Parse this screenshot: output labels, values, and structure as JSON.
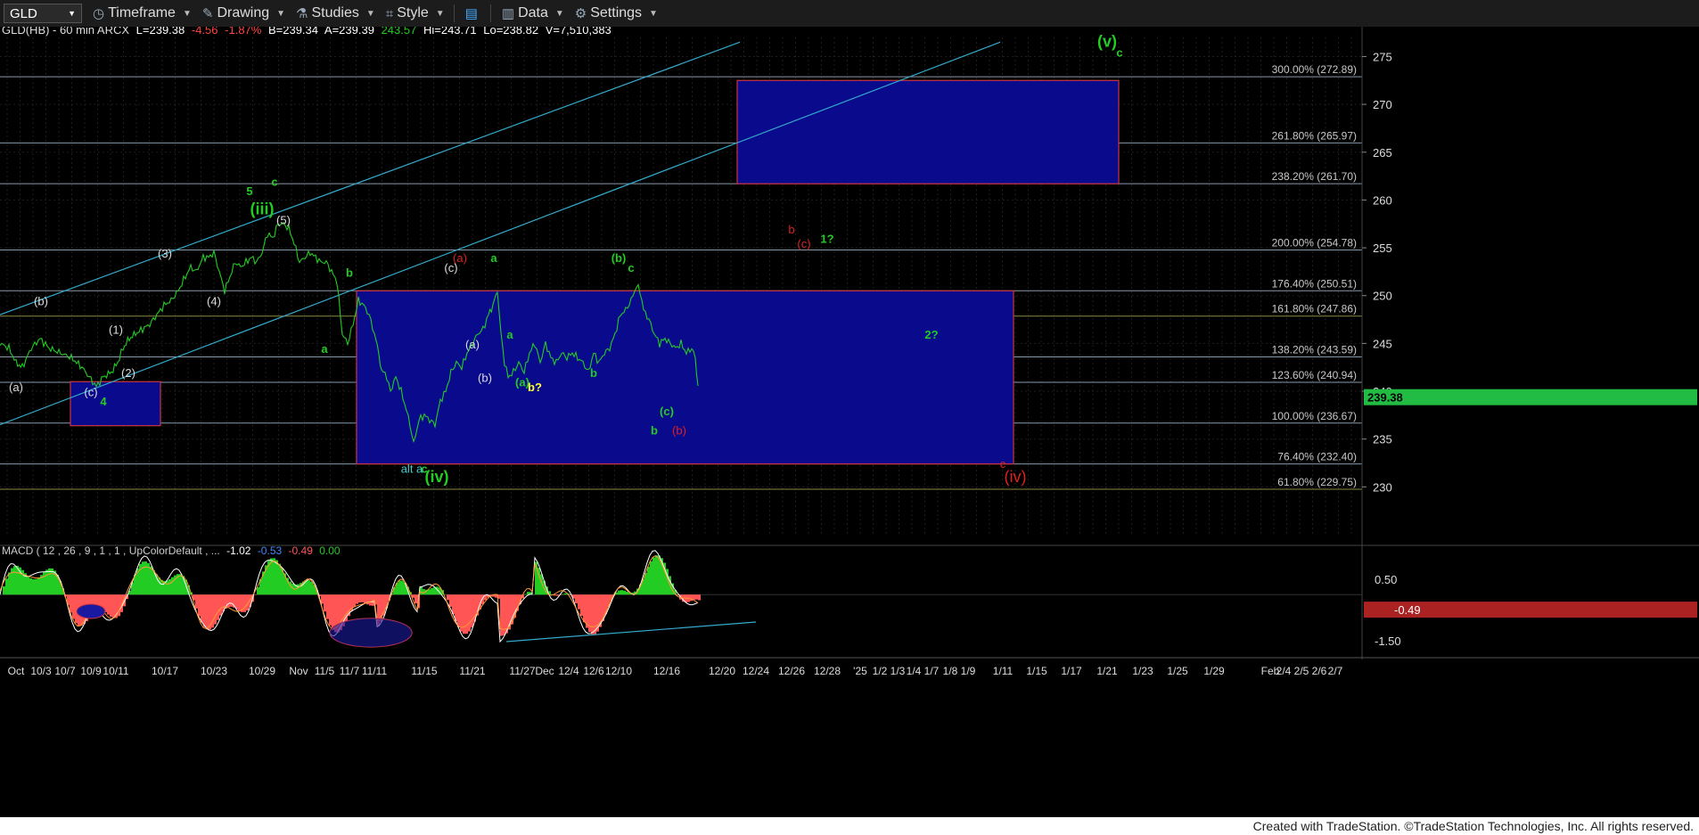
{
  "toolbar": {
    "symbol": "GLD",
    "timeframe_label": "Timeframe",
    "drawing_label": "Drawing",
    "studies_label": "Studies",
    "style_label": "Style",
    "data_label": "Data",
    "settings_label": "Settings",
    "icons": [
      "timeframe-icon",
      "drawing-icon",
      "studies-icon",
      "style-icon",
      "layout-icon",
      "data-icon",
      "settings-icon"
    ]
  },
  "header": {
    "line_prefix": "GLD(HB) - 60 min  ARCX",
    "last": "L=239.38",
    "change": "-4.56",
    "pct": "-1.87%",
    "bid": "B=239.34",
    "ask": "A=239.39",
    "open": "243.57",
    "hi": "Hi=243.71",
    "lo": "Lo=238.82",
    "vol": "V=7,510,383"
  },
  "colors": {
    "price_up": "#22cc22",
    "box_fill": "#0a0a8c",
    "box_border": "#cc3344",
    "fib_line": "#8899aa",
    "trend_line": "#33aacc",
    "green_label": "#22cc22",
    "red_label": "#dd2222",
    "white_label": "#dddddd",
    "yellow_label": "#ffff33",
    "last_price_bg": "#22bb44",
    "macd_neg": "#ff5555",
    "macd_pos": "#22cc22"
  },
  "chart_data": {
    "type": "line",
    "title": "GLD(HB) - 60 min",
    "xlabel": "",
    "ylabel": "",
    "ylim": [
      225,
      277
    ],
    "yticks": [
      230,
      235,
      240,
      245,
      250,
      255,
      260,
      265,
      270,
      275
    ],
    "xticks": [
      "Oct",
      "10/3",
      "10/7",
      "10/9",
      "10/11",
      "10/17",
      "10/23",
      "10/29",
      "Nov",
      "11/5",
      "11/7",
      "11/11",
      "11/15",
      "11/21",
      "11/27",
      "Dec",
      "12/4",
      "12/6",
      "12/10",
      "12/16",
      "12/20",
      "12/24",
      "12/26",
      "12/28",
      "'25",
      "1/2",
      "1/3",
      "1/4",
      "1/7",
      "1/8",
      "1/9",
      "1/11",
      "1/15",
      "1/17",
      "1/21",
      "1/23",
      "1/25",
      "1/29",
      "Feb",
      "2/4",
      "2/5",
      "2/6",
      "2/7"
    ],
    "last_price": "239.38",
    "price_path": [
      [
        0,
        245
      ],
      [
        10,
        244.5
      ],
      [
        18,
        243
      ],
      [
        25,
        242.5
      ],
      [
        35,
        244.5
      ],
      [
        45,
        245.5
      ],
      [
        55,
        244.5
      ],
      [
        68,
        244
      ],
      [
        80,
        243.5
      ],
      [
        92,
        242.5
      ],
      [
        100,
        241.5
      ],
      [
        108,
        240.5
      ],
      [
        116,
        241.5
      ],
      [
        125,
        242
      ],
      [
        132,
        243
      ],
      [
        138,
        244.5
      ],
      [
        145,
        245.5
      ],
      [
        152,
        246
      ],
      [
        160,
        246.5
      ],
      [
        168,
        247
      ],
      [
        176,
        248
      ],
      [
        184,
        249
      ],
      [
        192,
        249.5
      ],
      [
        200,
        250.5
      ],
      [
        208,
        252
      ],
      [
        214,
        253
      ],
      [
        220,
        252.5
      ],
      [
        228,
        254
      ],
      [
        234,
        254
      ],
      [
        240,
        254.5
      ],
      [
        246,
        252.5
      ],
      [
        252,
        250.5
      ],
      [
        258,
        252
      ],
      [
        264,
        253.5
      ],
      [
        270,
        253
      ],
      [
        276,
        253.5
      ],
      [
        282,
        254
      ],
      [
        288,
        253.5
      ],
      [
        294,
        254.5
      ],
      [
        300,
        256.5
      ],
      [
        306,
        256
      ],
      [
        312,
        257.5
      ],
      [
        318,
        257.5
      ],
      [
        324,
        257
      ],
      [
        330,
        255.5
      ],
      [
        336,
        253.5
      ],
      [
        342,
        254
      ],
      [
        348,
        254.5
      ],
      [
        354,
        254
      ],
      [
        360,
        253.5
      ],
      [
        366,
        253.5
      ],
      [
        372,
        252.5
      ],
      [
        378,
        251.5
      ],
      [
        384,
        246
      ],
      [
        390,
        245
      ],
      [
        396,
        247
      ],
      [
        402,
        249.5
      ],
      [
        408,
        249
      ],
      [
        414,
        248
      ],
      [
        420,
        246
      ],
      [
        425,
        244
      ],
      [
        428,
        242
      ],
      [
        432,
        242
      ],
      [
        438,
        240
      ],
      [
        444,
        241.5
      ],
      [
        450,
        240
      ],
      [
        456,
        238
      ],
      [
        460,
        236.5
      ],
      [
        464,
        234.5
      ],
      [
        470,
        237
      ],
      [
        476,
        237.5
      ],
      [
        482,
        237
      ],
      [
        488,
        236.5
      ],
      [
        494,
        239
      ],
      [
        500,
        240
      ],
      [
        506,
        242
      ],
      [
        512,
        243
      ],
      [
        518,
        242.5
      ],
      [
        524,
        244
      ],
      [
        530,
        245
      ],
      [
        536,
        246
      ],
      [
        542,
        246.5
      ],
      [
        548,
        248
      ],
      [
        553,
        249
      ],
      [
        558,
        250.5
      ],
      [
        562,
        246
      ],
      [
        566,
        243
      ],
      [
        570,
        241.5
      ],
      [
        576,
        242
      ],
      [
        582,
        243
      ],
      [
        588,
        242
      ],
      [
        594,
        244
      ],
      [
        600,
        245
      ],
      [
        606,
        243
      ],
      [
        612,
        245
      ],
      [
        618,
        243.5
      ],
      [
        624,
        243
      ],
      [
        630,
        244
      ],
      [
        636,
        243.5
      ],
      [
        642,
        244
      ],
      [
        648,
        243.5
      ],
      [
        654,
        243
      ],
      [
        660,
        242
      ],
      [
        666,
        244
      ],
      [
        672,
        243
      ],
      [
        678,
        244
      ],
      [
        684,
        244.5
      ],
      [
        690,
        246
      ],
      [
        696,
        248
      ],
      [
        702,
        248.5
      ],
      [
        708,
        249.5
      ],
      [
        714,
        251
      ],
      [
        718,
        250.5
      ],
      [
        722,
        248.5
      ],
      [
        728,
        247.5
      ],
      [
        734,
        246
      ],
      [
        740,
        245
      ],
      [
        746,
        245.5
      ],
      [
        752,
        245
      ],
      [
        758,
        244.5
      ],
      [
        764,
        245
      ],
      [
        770,
        244
      ],
      [
        776,
        244.5
      ],
      [
        780,
        243.5
      ],
      [
        783,
        240.5
      ],
      [
        785,
        239.38
      ]
    ],
    "fib_levels": [
      {
        "label": "300.00% (272.89)",
        "value": 272.89
      },
      {
        "label": "261.80% (265.97)",
        "value": 265.97
      },
      {
        "label": "238.20% (261.70)",
        "value": 261.7
      },
      {
        "label": "200.00% (254.78)",
        "value": 254.78
      },
      {
        "label": "176.40% (250.51)",
        "value": 250.51
      },
      {
        "label": "161.80% (247.86)",
        "value": 247.86
      },
      {
        "label": "138.20% (243.59)",
        "value": 243.59
      },
      {
        "label": "123.60% (240.94)",
        "value": 240.94
      },
      {
        "label": "100.00% (236.67)",
        "value": 236.67
      },
      {
        "label": "76.40% (232.40)",
        "value": 232.4
      },
      {
        "label": "61.80% (229.75)",
        "value": 229.75
      }
    ],
    "boxes": [
      {
        "name": "small-wave4-box",
        "y_top": 241.0,
        "y_bottom": 236.4,
        "x_range": [
          "10/7",
          "10/17"
        ]
      },
      {
        "name": "main-target-box",
        "y_top": 250.5,
        "y_bottom": 232.4,
        "x_range": [
          "11/7",
          "1/11"
        ]
      },
      {
        "name": "upper-target-box",
        "y_top": 272.5,
        "y_bottom": 261.7,
        "x_range": [
          "12/20",
          "1/23"
        ]
      }
    ],
    "wave_labels": [
      {
        "text": "(iii)",
        "color": "green",
        "price": 258.5,
        "pos": "10/29"
      },
      {
        "text": "c",
        "color": "green",
        "price": 261.5,
        "pos": "10/29"
      },
      {
        "text": "5",
        "color": "green",
        "price": 260.5,
        "pos": "10/29"
      },
      {
        "text": "(5)",
        "color": "white",
        "price": 257.5,
        "pos": "10/29"
      },
      {
        "text": "(3)",
        "color": "white",
        "price": 254,
        "pos": "10/17"
      },
      {
        "text": "(4)",
        "color": "white",
        "price": 249,
        "pos": "10/23"
      },
      {
        "text": "(1)",
        "color": "white",
        "price": 246,
        "pos": "10/11"
      },
      {
        "text": "(2)",
        "color": "white",
        "price": 241.5,
        "pos": "10/11"
      },
      {
        "text": "(b)",
        "color": "white",
        "price": 249,
        "pos": "10/3"
      },
      {
        "text": "(a)",
        "color": "white",
        "price": 240,
        "pos": "Oct"
      },
      {
        "text": "(c)",
        "color": "white",
        "price": 239.5,
        "pos": "10/9"
      },
      {
        "text": "4",
        "color": "green",
        "price": 238.5,
        "pos": "10/9"
      },
      {
        "text": "b",
        "color": "green",
        "price": 252,
        "pos": "11/7"
      },
      {
        "text": "a",
        "color": "green",
        "price": 244,
        "pos": "11/5"
      },
      {
        "text": "c",
        "color": "green",
        "price": 231.5,
        "pos": "11/15"
      },
      {
        "text": "(iv)",
        "color": "green",
        "price": 230.5,
        "pos": "11/15"
      },
      {
        "text": "alt a",
        "color": "cyan",
        "price": 231.5,
        "pos": "11/15"
      },
      {
        "text": "(a)",
        "color": "white",
        "price": 244.5,
        "pos": "11/21"
      },
      {
        "text": "(b)",
        "color": "white",
        "price": 241,
        "pos": "11/21"
      },
      {
        "text": "(a)",
        "color": "red",
        "price": 253.5,
        "pos": "11/21"
      },
      {
        "text": "a",
        "color": "green",
        "price": 253.5,
        "pos": "11/21"
      },
      {
        "text": "(c)",
        "color": "white",
        "price": 252.5,
        "pos": "11/21"
      },
      {
        "text": "(a)",
        "color": "green",
        "price": 240.5,
        "pos": "11/27"
      },
      {
        "text": "b?",
        "color": "yellow",
        "price": 240,
        "pos": "11/27"
      },
      {
        "text": "a",
        "color": "green",
        "price": 245.5,
        "pos": "11/27"
      },
      {
        "text": "b",
        "color": "green",
        "price": 241.5,
        "pos": "12/6"
      },
      {
        "text": "(b)",
        "color": "green",
        "price": 253.5,
        "pos": "12/10"
      },
      {
        "text": "c",
        "color": "green",
        "price": 252.5,
        "pos": "12/10"
      },
      {
        "text": "(c)",
        "color": "green",
        "price": 237.5,
        "pos": "12/16"
      },
      {
        "text": "(b)",
        "color": "red",
        "price": 235.5,
        "pos": "12/16"
      },
      {
        "text": "b",
        "color": "green",
        "price": 235.5,
        "pos": "12/16"
      },
      {
        "text": "b",
        "color": "red",
        "price": 256.5,
        "pos": "12/26"
      },
      {
        "text": "(c)",
        "color": "red",
        "price": 255,
        "pos": "12/26"
      },
      {
        "text": "1?",
        "color": "green",
        "price": 255.5,
        "pos": "12/28"
      },
      {
        "text": "2?",
        "color": "green",
        "price": 245.5,
        "pos": "1/7"
      },
      {
        "text": "c",
        "color": "red",
        "price": 232,
        "pos": "1/11"
      },
      {
        "text": "(iv)",
        "color": "red",
        "price": 230.5,
        "pos": "1/11"
      },
      {
        "text": "(v)",
        "color": "green",
        "price": 276,
        "pos": "1/21"
      },
      {
        "text": "c",
        "color": "green",
        "price": 275,
        "pos": "1/21"
      }
    ],
    "trend_lines": [
      {
        "name": "channel-upper",
        "from": {
          "px": 0,
          "price": 248
        },
        "to": {
          "px": 830,
          "price": 276.5
        }
      },
      {
        "name": "channel-lower",
        "from": {
          "px": 0,
          "price": 236.5
        },
        "to": {
          "px": 1122,
          "price": 276.5
        }
      }
    ],
    "macd": {
      "label": "MACD ( 12 , 26 , 9 , 1 , 1 , UpColorDefault , ...",
      "values": [
        "-1.02",
        "-0.53",
        "-0.49",
        "0.00"
      ],
      "ylim": [
        -2.0,
        1.2
      ],
      "yticks": [
        "0.50",
        "-1.50"
      ],
      "current": "-0.49"
    }
  },
  "footer": {
    "credit": "Created with TradeStation. ©TradeStation Technologies, Inc. All rights reserved."
  }
}
